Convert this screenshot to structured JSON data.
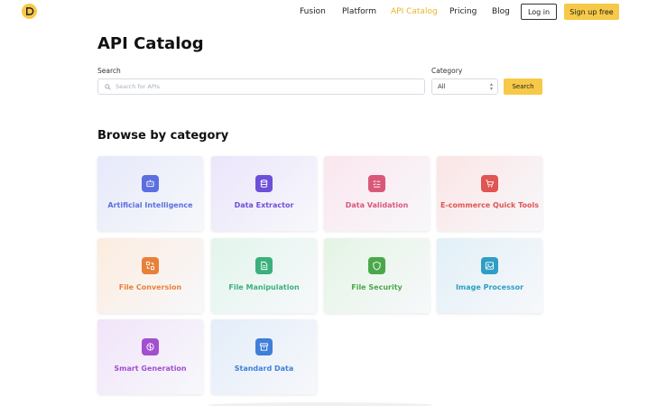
{
  "nav": {
    "links": [
      "Fusion",
      "Platform",
      "API Catalog",
      "Pricing",
      "Blog"
    ],
    "active": "API Catalog",
    "login": "Log in",
    "signup": "Sign up free"
  },
  "page": {
    "title": "API Catalog"
  },
  "search": {
    "label": "Search",
    "placeholder": "Search for APIs",
    "value": "",
    "category_label": "Category",
    "category_value": "All",
    "button": "Search"
  },
  "browse": {
    "title": "Browse by category",
    "categories": [
      {
        "label": "Artificial Intelligence",
        "color": "#5b6fe0",
        "bg": "#e6e9fa",
        "icon": "robot-icon"
      },
      {
        "label": "Data Extractor",
        "color": "#6d4fd8",
        "bg": "#ebe5fb",
        "icon": "database-icon"
      },
      {
        "label": "Data Validation",
        "color": "#d9587a",
        "bg": "#fbe6ee",
        "icon": "checklist-icon"
      },
      {
        "label": "E-commerce Quick Tools",
        "color": "#e05454",
        "bg": "#fbe5e5",
        "icon": "cart-icon"
      },
      {
        "label": "File Conversion",
        "color": "#e9803a",
        "bg": "#fcecdf",
        "icon": "convert-icon"
      },
      {
        "label": "File Manipulation",
        "color": "#3bb07c",
        "bg": "#e2f5ec",
        "icon": "file-edit-icon"
      },
      {
        "label": "File Security",
        "color": "#4aa84a",
        "bg": "#e4f4e4",
        "icon": "shield-icon"
      },
      {
        "label": "Image Processor",
        "color": "#2f9ec4",
        "bg": "#e1f0f7",
        "icon": "image-icon"
      },
      {
        "label": "Smart Generation",
        "color": "#a24fd0",
        "bg": "#f1e4f9",
        "icon": "brain-icon"
      },
      {
        "label": "Standard Data",
        "color": "#3f7fd8",
        "bg": "#e3edf9",
        "icon": "archive-icon"
      }
    ]
  }
}
